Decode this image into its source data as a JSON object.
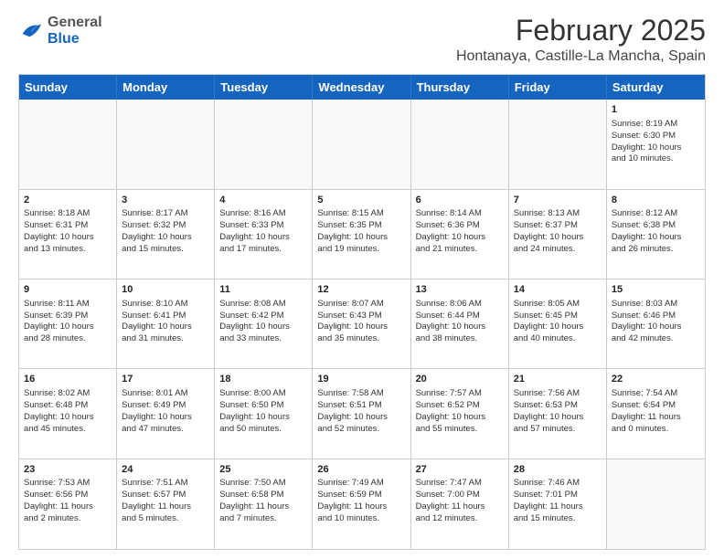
{
  "header": {
    "logo_general": "General",
    "logo_blue": "Blue",
    "month_title": "February 2025",
    "location": "Hontanaya, Castille-La Mancha, Spain"
  },
  "days_of_week": [
    "Sunday",
    "Monday",
    "Tuesday",
    "Wednesday",
    "Thursday",
    "Friday",
    "Saturday"
  ],
  "weeks": [
    [
      {
        "day": "",
        "info": "",
        "empty": true
      },
      {
        "day": "",
        "info": "",
        "empty": true
      },
      {
        "day": "",
        "info": "",
        "empty": true
      },
      {
        "day": "",
        "info": "",
        "empty": true
      },
      {
        "day": "",
        "info": "",
        "empty": true
      },
      {
        "day": "",
        "info": "",
        "empty": true
      },
      {
        "day": "1",
        "info": "Sunrise: 8:19 AM\nSunset: 6:30 PM\nDaylight: 10 hours\nand 10 minutes."
      }
    ],
    [
      {
        "day": "2",
        "info": "Sunrise: 8:18 AM\nSunset: 6:31 PM\nDaylight: 10 hours\nand 13 minutes."
      },
      {
        "day": "3",
        "info": "Sunrise: 8:17 AM\nSunset: 6:32 PM\nDaylight: 10 hours\nand 15 minutes."
      },
      {
        "day": "4",
        "info": "Sunrise: 8:16 AM\nSunset: 6:33 PM\nDaylight: 10 hours\nand 17 minutes."
      },
      {
        "day": "5",
        "info": "Sunrise: 8:15 AM\nSunset: 6:35 PM\nDaylight: 10 hours\nand 19 minutes."
      },
      {
        "day": "6",
        "info": "Sunrise: 8:14 AM\nSunset: 6:36 PM\nDaylight: 10 hours\nand 21 minutes."
      },
      {
        "day": "7",
        "info": "Sunrise: 8:13 AM\nSunset: 6:37 PM\nDaylight: 10 hours\nand 24 minutes."
      },
      {
        "day": "8",
        "info": "Sunrise: 8:12 AM\nSunset: 6:38 PM\nDaylight: 10 hours\nand 26 minutes."
      }
    ],
    [
      {
        "day": "9",
        "info": "Sunrise: 8:11 AM\nSunset: 6:39 PM\nDaylight: 10 hours\nand 28 minutes."
      },
      {
        "day": "10",
        "info": "Sunrise: 8:10 AM\nSunset: 6:41 PM\nDaylight: 10 hours\nand 31 minutes."
      },
      {
        "day": "11",
        "info": "Sunrise: 8:08 AM\nSunset: 6:42 PM\nDaylight: 10 hours\nand 33 minutes."
      },
      {
        "day": "12",
        "info": "Sunrise: 8:07 AM\nSunset: 6:43 PM\nDaylight: 10 hours\nand 35 minutes."
      },
      {
        "day": "13",
        "info": "Sunrise: 8:06 AM\nSunset: 6:44 PM\nDaylight: 10 hours\nand 38 minutes."
      },
      {
        "day": "14",
        "info": "Sunrise: 8:05 AM\nSunset: 6:45 PM\nDaylight: 10 hours\nand 40 minutes."
      },
      {
        "day": "15",
        "info": "Sunrise: 8:03 AM\nSunset: 6:46 PM\nDaylight: 10 hours\nand 42 minutes."
      }
    ],
    [
      {
        "day": "16",
        "info": "Sunrise: 8:02 AM\nSunset: 6:48 PM\nDaylight: 10 hours\nand 45 minutes."
      },
      {
        "day": "17",
        "info": "Sunrise: 8:01 AM\nSunset: 6:49 PM\nDaylight: 10 hours\nand 47 minutes."
      },
      {
        "day": "18",
        "info": "Sunrise: 8:00 AM\nSunset: 6:50 PM\nDaylight: 10 hours\nand 50 minutes."
      },
      {
        "day": "19",
        "info": "Sunrise: 7:58 AM\nSunset: 6:51 PM\nDaylight: 10 hours\nand 52 minutes."
      },
      {
        "day": "20",
        "info": "Sunrise: 7:57 AM\nSunset: 6:52 PM\nDaylight: 10 hours\nand 55 minutes."
      },
      {
        "day": "21",
        "info": "Sunrise: 7:56 AM\nSunset: 6:53 PM\nDaylight: 10 hours\nand 57 minutes."
      },
      {
        "day": "22",
        "info": "Sunrise: 7:54 AM\nSunset: 6:54 PM\nDaylight: 11 hours\nand 0 minutes."
      }
    ],
    [
      {
        "day": "23",
        "info": "Sunrise: 7:53 AM\nSunset: 6:56 PM\nDaylight: 11 hours\nand 2 minutes."
      },
      {
        "day": "24",
        "info": "Sunrise: 7:51 AM\nSunset: 6:57 PM\nDaylight: 11 hours\nand 5 minutes."
      },
      {
        "day": "25",
        "info": "Sunrise: 7:50 AM\nSunset: 6:58 PM\nDaylight: 11 hours\nand 7 minutes."
      },
      {
        "day": "26",
        "info": "Sunrise: 7:49 AM\nSunset: 6:59 PM\nDaylight: 11 hours\nand 10 minutes."
      },
      {
        "day": "27",
        "info": "Sunrise: 7:47 AM\nSunset: 7:00 PM\nDaylight: 11 hours\nand 12 minutes."
      },
      {
        "day": "28",
        "info": "Sunrise: 7:46 AM\nSunset: 7:01 PM\nDaylight: 11 hours\nand 15 minutes."
      },
      {
        "day": "",
        "info": "",
        "empty": true
      }
    ]
  ]
}
